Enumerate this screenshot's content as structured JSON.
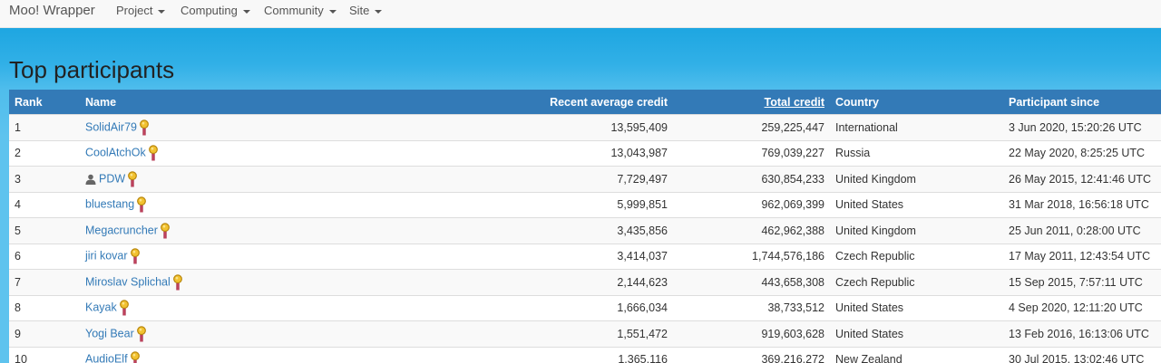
{
  "navbar": {
    "brand": "Moo! Wrapper",
    "items": [
      {
        "label": "Project"
      },
      {
        "label": "Computing"
      },
      {
        "label": "Community"
      },
      {
        "label": "Site"
      }
    ]
  },
  "page": {
    "title": "Top participants"
  },
  "table": {
    "headers": {
      "rank": "Rank",
      "name": "Name",
      "rac": "Recent average credit",
      "total": "Total credit",
      "country": "Country",
      "since": "Participant since"
    },
    "sorted_by": "total",
    "rows": [
      {
        "rank": "1",
        "name": "SolidAir79",
        "rac": "13,595,409",
        "total": "259,225,447",
        "country": "International",
        "since": "3 Jun 2020, 15:20:26 UTC",
        "user_icon": false
      },
      {
        "rank": "2",
        "name": "CoolAtchOk",
        "rac": "13,043,987",
        "total": "769,039,227",
        "country": "Russia",
        "since": "22 May 2020, 8:25:25 UTC",
        "user_icon": false
      },
      {
        "rank": "3",
        "name": "PDW",
        "rac": "7,729,497",
        "total": "630,854,233",
        "country": "United Kingdom",
        "since": "26 May 2015, 12:41:46 UTC",
        "user_icon": true
      },
      {
        "rank": "4",
        "name": "bluestang",
        "rac": "5,999,851",
        "total": "962,069,399",
        "country": "United States",
        "since": "31 Mar 2018, 16:56:18 UTC",
        "user_icon": false
      },
      {
        "rank": "5",
        "name": "Megacruncher",
        "rac": "3,435,856",
        "total": "462,962,388",
        "country": "United Kingdom",
        "since": "25 Jun 2011, 0:28:00 UTC",
        "user_icon": false
      },
      {
        "rank": "6",
        "name": "jiri kovar",
        "rac": "3,414,037",
        "total": "1,744,576,186",
        "country": "Czech Republic",
        "since": "17 May 2011, 12:43:54 UTC",
        "user_icon": false
      },
      {
        "rank": "7",
        "name": "Miroslav Splichal",
        "rac": "2,144,623",
        "total": "443,658,308",
        "country": "Czech Republic",
        "since": "15 Sep 2015, 7:57:11 UTC",
        "user_icon": false
      },
      {
        "rank": "8",
        "name": "Kayak",
        "rac": "1,666,034",
        "total": "38,733,512",
        "country": "United States",
        "since": "4 Sep 2020, 12:11:20 UTC",
        "user_icon": false
      },
      {
        "rank": "9",
        "name": "Yogi Bear",
        "rac": "1,551,472",
        "total": "919,603,628",
        "country": "United States",
        "since": "13 Feb 2016, 16:13:06 UTC",
        "user_icon": false
      },
      {
        "rank": "10",
        "name": "AudioElf",
        "rac": "1,365,116",
        "total": "369,216,272",
        "country": "New Zealand",
        "since": "30 Jul 2015, 13:02:46 UTC",
        "user_icon": false
      }
    ]
  },
  "icons": {
    "badge": "medal-icon",
    "profile": "user-icon"
  },
  "colors": {
    "header_bg": "#337ab7",
    "link": "#337ab7",
    "banner": "#31b0e7"
  }
}
